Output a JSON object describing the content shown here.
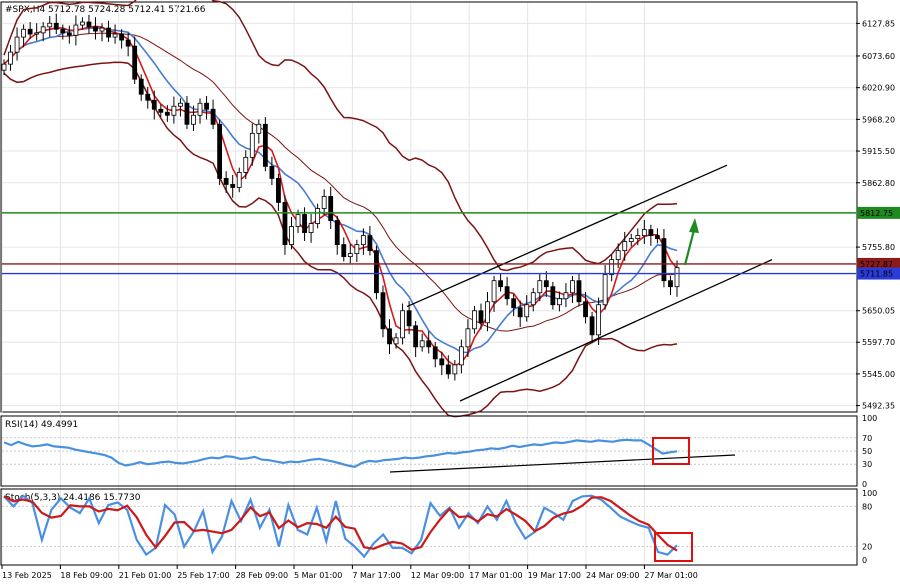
{
  "chart_data": [
    {
      "type": "candlestick",
      "header": "#SPX,H4  5712.78 5724.28 5712.41 5721.66",
      "symbol": "#SPX",
      "timeframe": "H4",
      "last_bar": {
        "open": 5712.78,
        "high": 5724.28,
        "low": 5712.41,
        "close": 5721.66
      },
      "y_ticks": [
        "6127.85",
        "6073.60",
        "6020.90",
        "5968.20",
        "5915.50",
        "5862.80",
        "5755.80",
        "5650.05",
        "5597.70",
        "5545.00",
        "5492.35"
      ],
      "y_tick_values": [
        6127.85,
        6073.6,
        6020.9,
        5968.2,
        5915.5,
        5862.8,
        5755.8,
        5650.05,
        5597.7,
        5545.0,
        5492.35
      ],
      "ylim": [
        5485,
        6160
      ],
      "x_tick_labels": [
        "13 Feb 2025",
        "18 Feb 09:00",
        "21 Feb 01:00",
        "25 Feb 17:00",
        "28 Feb 09:00",
        "5 Mar 01:00",
        "7 Mar 17:00",
        "12 Mar 09:00",
        "17 Mar 01:00",
        "19 Mar 17:00",
        "24 Mar 09:00",
        "27 Mar 01:00"
      ],
      "levels": [
        {
          "label": "5812.75",
          "value": 5812.75,
          "color": "#1f8a1f"
        },
        {
          "label": "5727.87",
          "value": 5727.87,
          "color": "#8b1a1a"
        },
        {
          "label": "5711.85",
          "value": 5711.85,
          "color": "#2b3bd6"
        }
      ],
      "closes": [
        6060,
        6080,
        6105,
        6118,
        6110,
        6112,
        6122,
        6128,
        6118,
        6112,
        6108,
        6125,
        6130,
        6122,
        6115,
        6120,
        6105,
        6110,
        6100,
        6090,
        6035,
        6010,
        6000,
        5985,
        5980,
        5975,
        5990,
        5995,
        5960,
        5975,
        5995,
        5985,
        5960,
        5870,
        5860,
        5855,
        5880,
        5905,
        5945,
        5960,
        5890,
        5870,
        5830,
        5760,
        5790,
        5810,
        5780,
        5795,
        5820,
        5840,
        5800,
        5760,
        5740,
        5745,
        5760,
        5775,
        5750,
        5680,
        5620,
        5595,
        5605,
        5650,
        5625,
        5590,
        5600,
        5590,
        5570,
        5560,
        5545,
        5560,
        5590,
        5620,
        5650,
        5630,
        5665,
        5700,
        5690,
        5670,
        5655,
        5640,
        5660,
        5680,
        5700,
        5690,
        5660,
        5670,
        5680,
        5700,
        5665,
        5640,
        5610,
        5660,
        5710,
        5735,
        5750,
        5765,
        5770,
        5775,
        5785,
        5775,
        5770,
        5700,
        5690,
        5721.66
      ],
      "channel": {
        "upper": [
          [
            5650,
            5735
          ],
          [
            5880,
            5845
          ]
        ],
        "lower": [
          [
            5500,
            5520
          ],
          [
            5720,
            5730
          ]
        ]
      },
      "arrow": "up"
    },
    {
      "type": "line",
      "label": "RSI(14) 49.4991",
      "name": "RSI(14)",
      "last_value": 49.4991,
      "ylim": [
        0,
        100
      ],
      "y_ticks": [
        "100",
        "70",
        "50",
        "30",
        "0"
      ],
      "values": [
        63,
        59,
        64,
        60,
        57,
        58,
        60,
        57,
        56,
        55,
        52,
        50,
        48,
        46,
        44,
        40,
        32,
        28,
        30,
        33,
        30,
        31,
        33,
        34,
        32,
        31,
        33,
        35,
        38,
        40,
        39,
        42,
        41,
        38,
        39,
        41,
        37,
        36,
        34,
        32,
        34,
        33,
        35,
        37,
        38,
        36,
        34,
        31,
        28,
        26,
        32,
        35,
        34,
        36,
        37,
        38,
        40,
        39,
        40,
        42,
        43,
        45,
        47,
        46,
        48,
        49,
        51,
        52,
        54,
        53,
        55,
        58,
        56,
        58,
        60,
        59,
        61,
        63,
        62,
        64,
        66,
        65,
        64,
        66,
        65,
        64,
        66,
        67,
        66,
        66,
        60,
        53,
        46,
        48,
        49.5
      ],
      "trendline": {
        "from": 25,
        "to": 42
      },
      "color": "#4a90e2"
    },
    {
      "type": "line",
      "label": "Stoch(5,3,3) 24.4186 15.7730",
      "name": "Stoch(5,3,3)",
      "main_value": 24.4186,
      "signal_value": 15.773,
      "ylim": [
        0,
        100
      ],
      "y_ticks": [
        "100",
        "80",
        "20",
        "0"
      ],
      "main": [
        95,
        80,
        96,
        85,
        30,
        75,
        92,
        78,
        70,
        92,
        55,
        82,
        86,
        75,
        30,
        8,
        18,
        82,
        68,
        20,
        42,
        73,
        12,
        35,
        88,
        58,
        90,
        48,
        75,
        20,
        82,
        45,
        38,
        78,
        28,
        88,
        32,
        20,
        5,
        25,
        38,
        18,
        18,
        10,
        30,
        85,
        66,
        78,
        48,
        70,
        55,
        80,
        60,
        88,
        55,
        32,
        42,
        78,
        70,
        60,
        88,
        95,
        96,
        90,
        78,
        65,
        58,
        52,
        48,
        12,
        8,
        22
      ],
      "main_color": "#4a90e2",
      "signal_color": "#cc1a1a"
    }
  ],
  "page": {
    "background": "#ffffff",
    "grid_color": "#e6e6e6",
    "text_color": "#000000"
  }
}
